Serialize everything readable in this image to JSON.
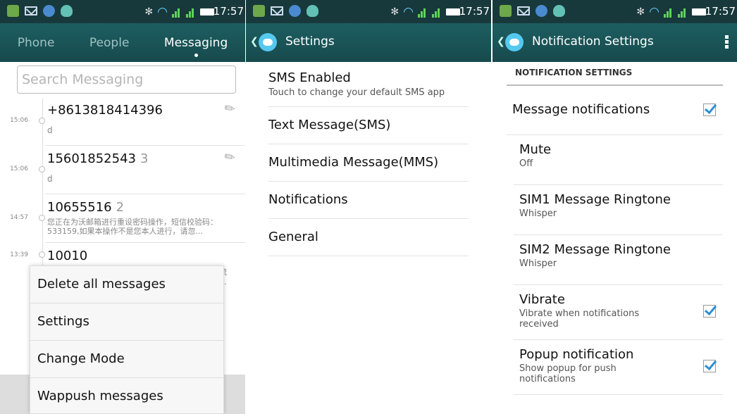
{
  "status": {
    "time": "17:57"
  },
  "messaging": {
    "tabs": [
      "Phone",
      "People",
      "Messaging"
    ],
    "search_placeholder": "Search Messaging",
    "threads": [
      {
        "time": "15:06",
        "name": "+8613818414396",
        "count": "",
        "preview": "d"
      },
      {
        "time": "15:06",
        "name": "15601852543",
        "count": "3",
        "preview": "d"
      },
      {
        "time": "14:57",
        "name": "10655516",
        "count": "2",
        "preview": "您正在为沃邮箱进行重设密码操作，短信校验码：533159,如果本操作不是您本人进行，请忽..."
      },
      {
        "time": "13:39",
        "name": "10010",
        "count": "",
        "preview": ""
      }
    ],
    "menu_underlay": [
      "结流",
      "内..."
    ],
    "menu": [
      "Delete all messages",
      "Settings",
      "Change Mode",
      "Wappush messages"
    ]
  },
  "settings": {
    "title": "Settings",
    "items": [
      {
        "title": "SMS Enabled",
        "subtitle": "Touch to change your default SMS app"
      },
      {
        "title": "Text Message(SMS)"
      },
      {
        "title": "Multimedia Message(MMS)"
      },
      {
        "title": "Notifications"
      },
      {
        "title": "General"
      }
    ]
  },
  "notification": {
    "title": "Notification Settings",
    "category": "NOTIFICATION SETTINGS",
    "items": [
      {
        "title": "Message notifications",
        "subtitle": "",
        "checked": true
      },
      {
        "title": "Mute",
        "subtitle": "Off",
        "checked": null
      },
      {
        "title": "SIM1 Message Ringtone",
        "subtitle": "Whisper",
        "checked": null
      },
      {
        "title": "SIM2 Message Ringtone",
        "subtitle": "Whisper",
        "checked": null
      },
      {
        "title": "Vibrate",
        "subtitle": "Vibrate when notifications received",
        "checked": true
      },
      {
        "title": "Popup notification",
        "subtitle": "Show popup for push notifications",
        "checked": true
      }
    ]
  },
  "colors": {
    "header": "#1d5e61",
    "statusbar": "#18393b",
    "check": "#2a8fd6",
    "accent": "#55c8f0"
  },
  "icons": [
    "back-icon",
    "app-icon",
    "overflow-icon",
    "attachment-icon",
    "wifi-icon",
    "signal-icon",
    "battery-icon",
    "bluetooth-icon"
  ]
}
